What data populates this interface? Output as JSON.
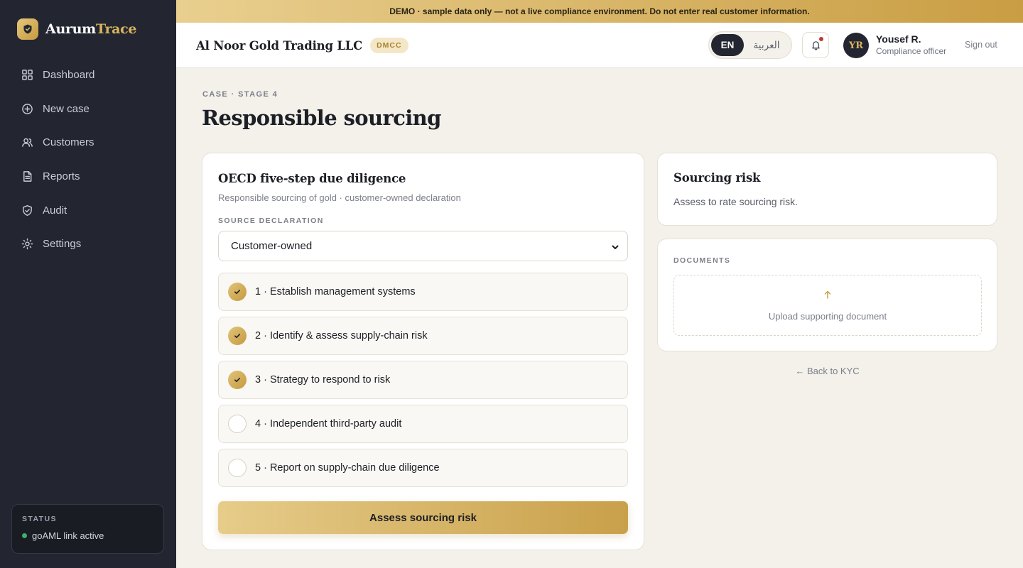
{
  "brand": {
    "name_part1": "Aurum",
    "name_part2": "Trace",
    "accent": "#d8b45e"
  },
  "sidebar": {
    "items": [
      {
        "label": "Dashboard",
        "icon": "grid-icon"
      },
      {
        "label": "New case",
        "icon": "plus-circle-icon"
      },
      {
        "label": "Customers",
        "icon": "users-icon"
      },
      {
        "label": "Reports",
        "icon": "document-icon"
      },
      {
        "label": "Audit",
        "icon": "shield-check-icon"
      },
      {
        "label": "Settings",
        "icon": "gear-icon"
      }
    ],
    "status": {
      "label": "STATUS",
      "text": "goAML link active",
      "dot_color": "#3fae6a"
    }
  },
  "banner": {
    "text": "DEMO · sample data only — not a live compliance environment. Do not enter real customer information."
  },
  "topbar": {
    "org_name": "Al Noor Gold Trading LLC",
    "org_badge": "DMCC",
    "lang_en": "EN",
    "lang_ar": "العربية",
    "user_initials": "YR",
    "user_name": "Yousef R.",
    "user_role": "Compliance officer",
    "signout": "Sign out"
  },
  "page": {
    "eyebrow": "CASE · STAGE 4",
    "title": "Responsible sourcing"
  },
  "diligence": {
    "title": "OECD five-step due diligence",
    "subtitle": "Responsible sourcing of gold · customer-owned declaration",
    "field_label": "SOURCE DECLARATION",
    "selected": "Customer-owned",
    "steps": [
      {
        "label": "1 · Establish management systems",
        "done": true
      },
      {
        "label": "2 · Identify & assess supply-chain risk",
        "done": true
      },
      {
        "label": "3 · Strategy to respond to risk",
        "done": true
      },
      {
        "label": "4 · Independent third-party audit",
        "done": false
      },
      {
        "label": "5 · Report on supply-chain due diligence",
        "done": false
      }
    ],
    "button": "Assess sourcing risk"
  },
  "risk": {
    "title": "Sourcing risk",
    "text": "Assess to rate sourcing risk."
  },
  "documents": {
    "label": "DOCUMENTS",
    "upload_text": "Upload supporting document"
  },
  "back_link": "← Back to KYC"
}
